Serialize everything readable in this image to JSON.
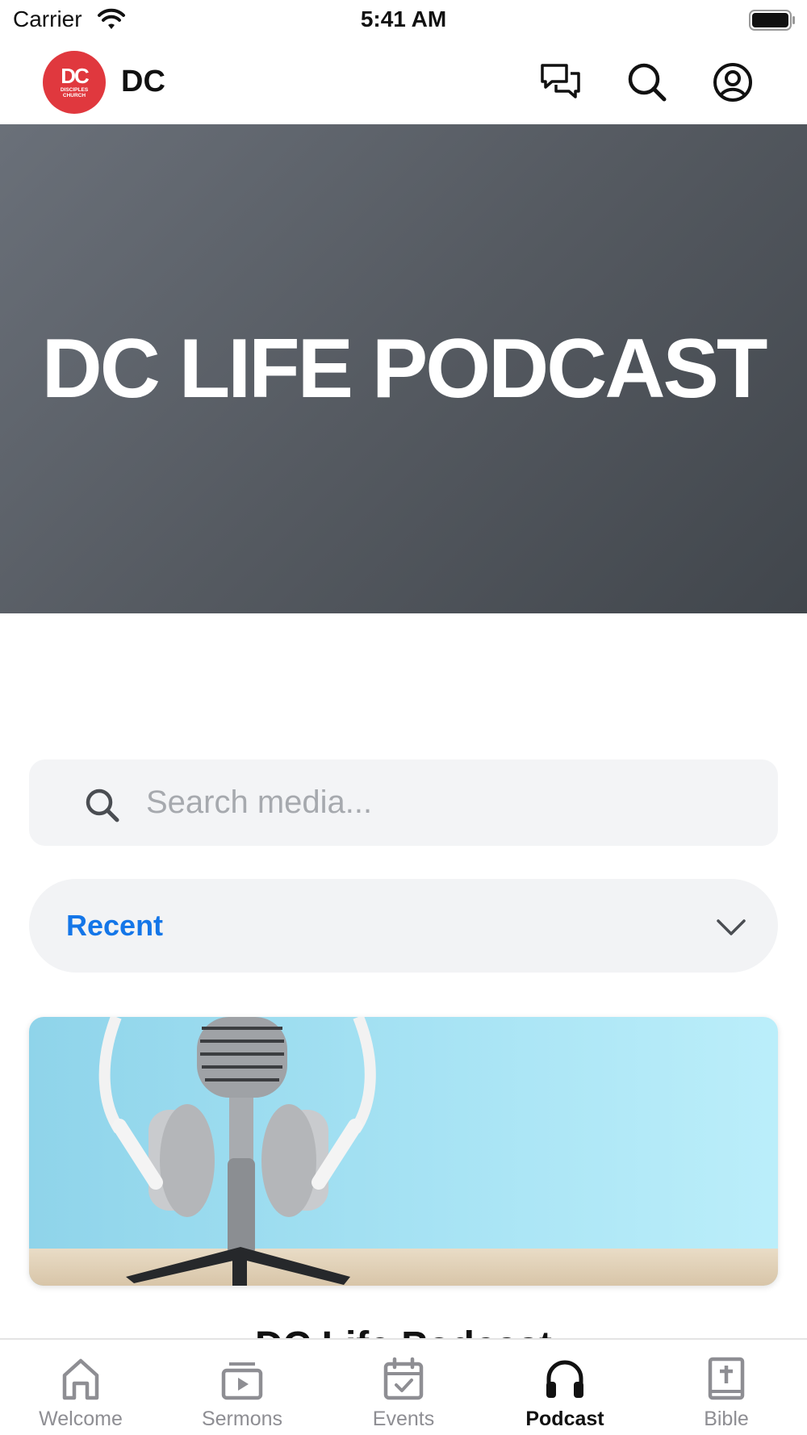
{
  "status_bar": {
    "carrier": "Carrier",
    "time": "5:41 AM"
  },
  "header": {
    "app_name": "DC",
    "logo": {
      "monogram": "DC",
      "subtext_line1": "DISCIPLES",
      "subtext_line2": "CHURCH",
      "color": "#e0383e"
    },
    "icons": [
      "chat-icon",
      "search-icon",
      "profile-icon"
    ]
  },
  "hero": {
    "title": "DC LIFE PODCAST"
  },
  "search": {
    "placeholder": "Search media..."
  },
  "sort": {
    "selected": "Recent",
    "accent_color": "#1476e8"
  },
  "media": {
    "partial_title": "DC Life Podcast"
  },
  "tabs": [
    {
      "label": "Welcome",
      "icon": "home-icon",
      "active": false
    },
    {
      "label": "Sermons",
      "icon": "video-icon",
      "active": false
    },
    {
      "label": "Events",
      "icon": "calendar-icon",
      "active": false
    },
    {
      "label": "Podcast",
      "icon": "headphones-icon",
      "active": true
    },
    {
      "label": "Bible",
      "icon": "bible-icon",
      "active": false
    }
  ]
}
